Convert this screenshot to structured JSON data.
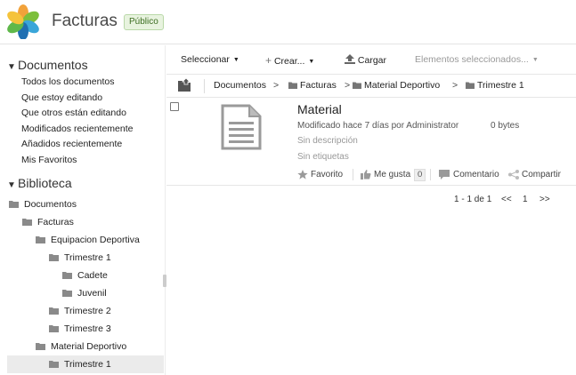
{
  "header": {
    "site_title": "Facturas",
    "visibility": "Público"
  },
  "sidebar": {
    "documents_title": "Documentos",
    "filters": [
      "Todos los documentos",
      "Que estoy editando",
      "Que otros están editando",
      "Modificados recientemente",
      "Añadidos recientemente",
      "Mis Favoritos"
    ],
    "library_title": "Biblioteca",
    "tree": [
      {
        "label": "Documentos",
        "depth": 0,
        "selected": false
      },
      {
        "label": "Facturas",
        "depth": 1,
        "selected": false
      },
      {
        "label": "Equipacion Deportiva",
        "depth": 2,
        "selected": false
      },
      {
        "label": "Trimestre 1",
        "depth": 3,
        "selected": false
      },
      {
        "label": "Cadete",
        "depth": 4,
        "selected": false
      },
      {
        "label": "Juvenil",
        "depth": 4,
        "selected": false
      },
      {
        "label": "Trimestre 2",
        "depth": 3,
        "selected": false
      },
      {
        "label": "Trimestre 3",
        "depth": 3,
        "selected": false
      },
      {
        "label": "Material Deportivo",
        "depth": 2,
        "selected": false
      },
      {
        "label": "Trimestre 1",
        "depth": 3,
        "selected": true
      }
    ]
  },
  "toolbar": {
    "select_label": "Seleccionar",
    "create_label": "Crear...",
    "upload_label": "Cargar",
    "selected_items_label": "Elementos seleccionados..."
  },
  "breadcrumb": [
    "Documentos",
    "Facturas",
    "Material Deportivo",
    "Trimestre 1"
  ],
  "breadcrumb_separator": ">",
  "document": {
    "name": "Material",
    "modified": "Modificado hace 7 días por Administrator",
    "size": "0 bytes",
    "description": "Sin descripción",
    "tags": "Sin etiquetas",
    "favorite_label": "Favorito",
    "like_label": "Me gusta",
    "like_count": "0",
    "comment_label": "Comentario",
    "share_label": "Compartir"
  },
  "pagination": {
    "range": "1 - 1 de 1",
    "prev": "<<",
    "page": "1",
    "next": ">>"
  },
  "colors": {
    "badge_bg": "#e8f3df",
    "badge_text": "#3d6e22",
    "folder": "#8a8a8a",
    "selected_row": "#ebebeb"
  }
}
